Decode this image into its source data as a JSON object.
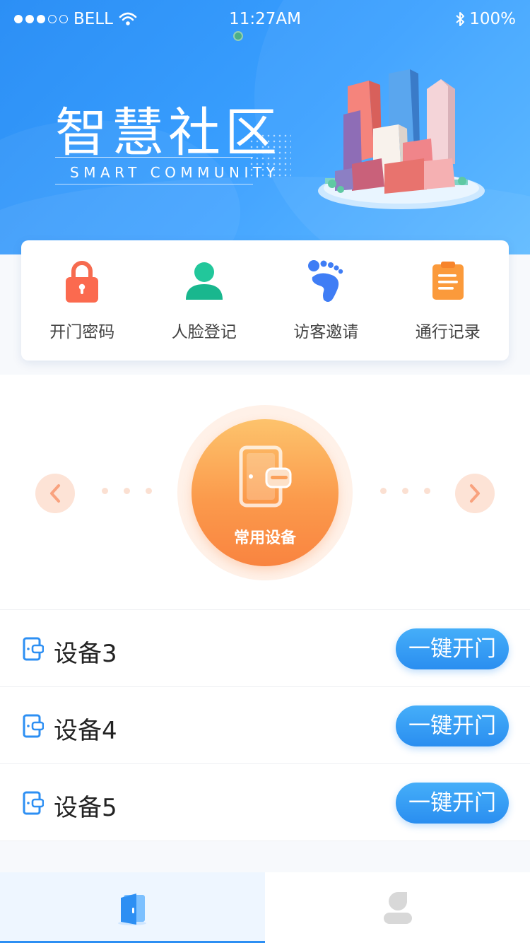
{
  "status_bar": {
    "carrier": "BELL",
    "time": "11:27AM",
    "battery": "100%"
  },
  "hero": {
    "title_cn": "智慧社区",
    "title_en": "SMART COMMUNITY"
  },
  "quick_actions": [
    {
      "label": "开门密码",
      "icon": "lock-icon",
      "color": "#fb6a4f"
    },
    {
      "label": "人脸登记",
      "icon": "person-icon",
      "color": "#1fbf95"
    },
    {
      "label": "访客邀请",
      "icon": "footprint-icon",
      "color": "#3f7df5"
    },
    {
      "label": "通行记录",
      "icon": "clipboard-icon",
      "color": "#fb9a3b"
    }
  ],
  "carousel": {
    "center_label": "常用设备"
  },
  "devices": [
    {
      "name": "设备3",
      "button": "一键开门"
    },
    {
      "name": "设备4",
      "button": "一键开门"
    },
    {
      "name": "设备5",
      "button": "一键开门"
    }
  ],
  "tabs": [
    {
      "icon": "door-icon",
      "active": true
    },
    {
      "icon": "user-icon",
      "active": false
    }
  ],
  "colors": {
    "primary": "#2d8ff3",
    "accent_orange": "#fb9a4c"
  }
}
